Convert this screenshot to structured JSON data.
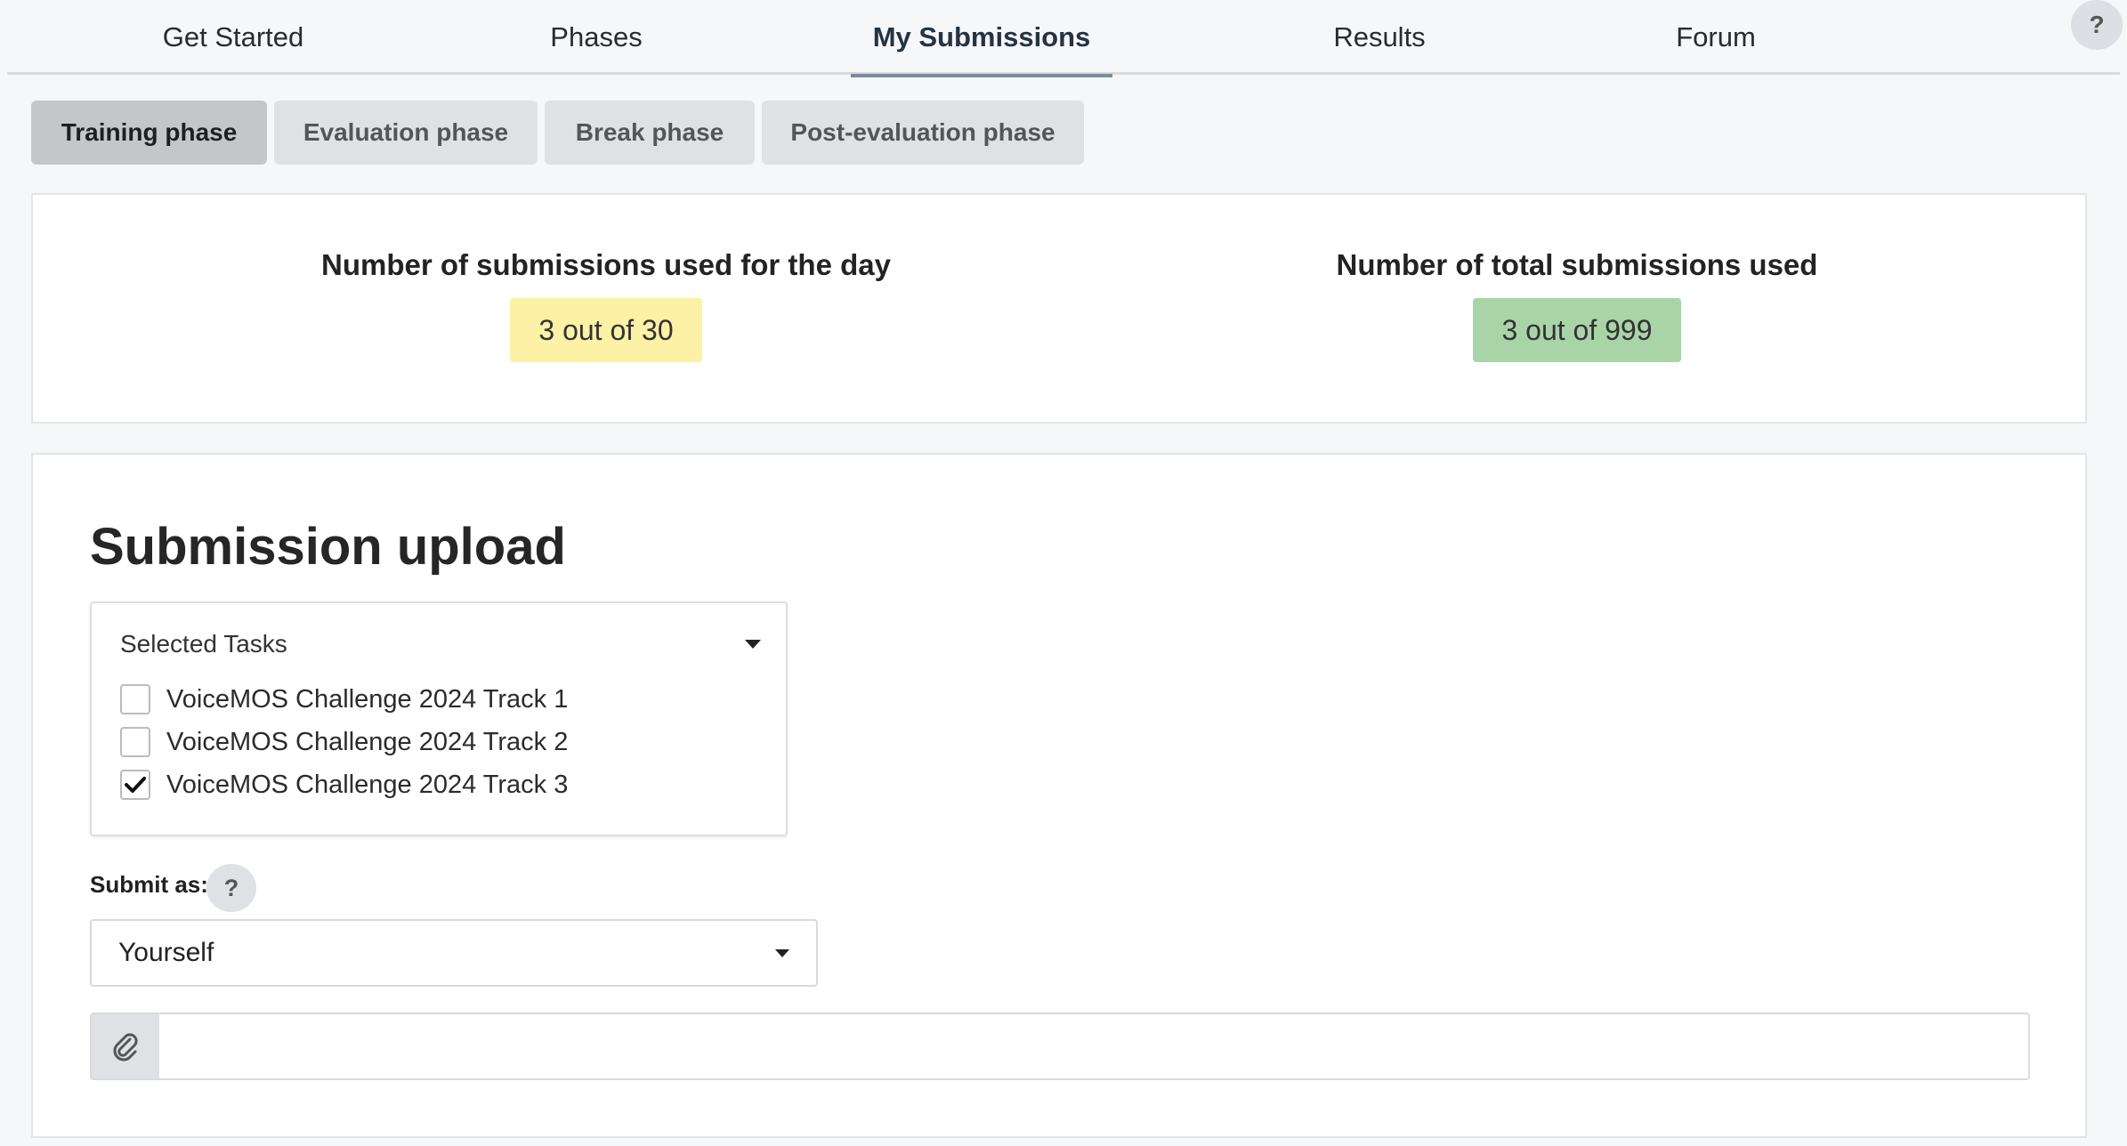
{
  "nav": {
    "items": [
      {
        "label": "Get Started"
      },
      {
        "label": "Phases"
      },
      {
        "label": "My Submissions"
      },
      {
        "label": "Results"
      },
      {
        "label": "Forum"
      }
    ],
    "active_index": 2,
    "help_label": "?"
  },
  "phases": {
    "tabs": [
      {
        "label": "Training phase"
      },
      {
        "label": "Evaluation phase"
      },
      {
        "label": "Break phase"
      },
      {
        "label": "Post-evaluation phase"
      }
    ],
    "active_index": 0
  },
  "stats": {
    "daily": {
      "title": "Number of submissions used for the day",
      "value": "3 out of 30",
      "color": "#fdf1a6"
    },
    "total": {
      "title": "Number of total submissions used",
      "value": "3 out of 999",
      "color": "#a9d4a8"
    }
  },
  "upload": {
    "title": "Submission upload",
    "tasks_label": "Selected Tasks",
    "tasks": [
      {
        "label": "VoiceMOS Challenge 2024 Track 1",
        "checked": false
      },
      {
        "label": "VoiceMOS Challenge 2024 Track 2",
        "checked": false
      },
      {
        "label": "VoiceMOS Challenge 2024 Track 3",
        "checked": true
      }
    ],
    "submit_as_label": "Submit as:",
    "submit_as_help": "?",
    "submit_as_value": "Yourself",
    "file_icon": "paperclip-icon"
  }
}
